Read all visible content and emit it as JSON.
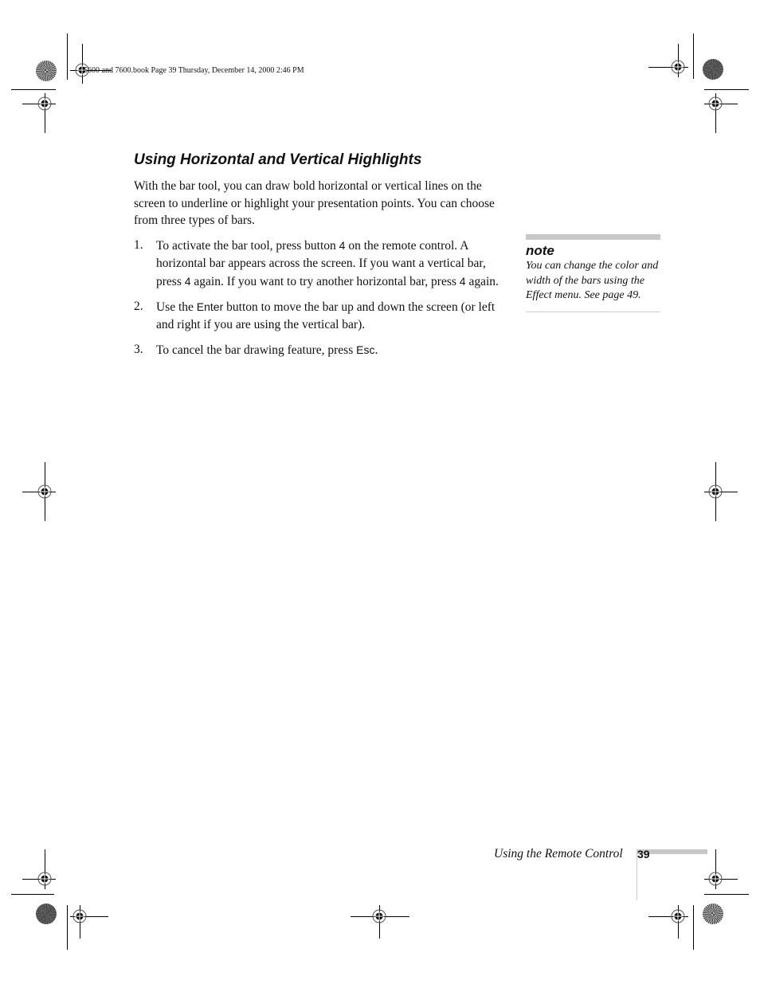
{
  "slug": "5600 and 7600.book  Page 39  Thursday, December 14, 2000  2:46 PM",
  "section": {
    "title": "Using Horizontal and Vertical Highlights",
    "intro": "With the bar tool, you can draw bold horizontal or vertical lines on the screen to underline or highlight your presentation points. You can choose from three types of bars."
  },
  "steps": [
    {
      "num": "1.",
      "parts": [
        "To activate the bar tool, press button ",
        "4",
        " on the remote control. A horizontal bar appears across the screen. If you want a vertical bar, press ",
        "4",
        " again. If you want to try another horizontal bar, press ",
        "4",
        " again."
      ]
    },
    {
      "num": "2.",
      "parts": [
        "Use the ",
        "Enter",
        " button to move the bar up and down the screen (or left and right if you are using the vertical bar)."
      ]
    },
    {
      "num": "3.",
      "parts": [
        "To cancel the bar drawing feature, press ",
        "Esc",
        "."
      ]
    }
  ],
  "note": {
    "label": "note",
    "text": "You can change the color and width of the bars using the Effect menu. See page 49."
  },
  "footer": {
    "chapter": "Using the Remote Control",
    "page": "39"
  }
}
